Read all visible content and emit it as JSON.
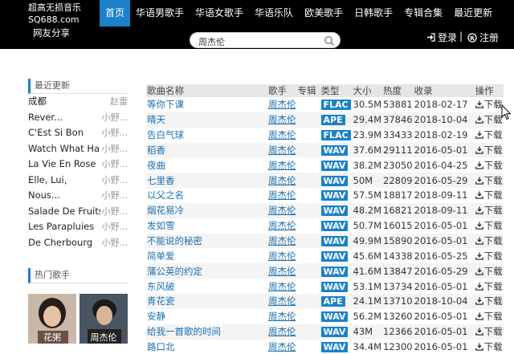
{
  "brand": {
    "line1": "超高无损音乐",
    "line2": "SQ688.com",
    "line3": "网友分享"
  },
  "nav": [
    {
      "label": "首页",
      "active": true
    },
    {
      "label": "华语男歌手"
    },
    {
      "label": "华语女歌手"
    },
    {
      "label": "华语乐队"
    },
    {
      "label": "欧美歌手"
    },
    {
      "label": "日韩歌手"
    },
    {
      "label": "专辑合集"
    },
    {
      "label": "最近更新"
    }
  ],
  "search": {
    "value": "周杰伦"
  },
  "auth": {
    "login": "登录",
    "register": "注册",
    "separator": "|"
  },
  "sidebar": {
    "recent_title": "最近更新",
    "recent": [
      {
        "title": "成都",
        "uploader": "赵雷"
      },
      {
        "title": "Rever...",
        "uploader": "小野..."
      },
      {
        "title": "C'Est Si Bon",
        "uploader": "小野..."
      },
      {
        "title": "Watch What Happens",
        "uploader": "小野..."
      },
      {
        "title": "La Vie En Rose",
        "uploader": "小野..."
      },
      {
        "title": "Elle, Lui,",
        "uploader": "小野..."
      },
      {
        "title": "Nous...",
        "uploader": "小野..."
      },
      {
        "title": "Salade De Fruits",
        "uploader": "小野..."
      },
      {
        "title": "Les Parapluies",
        "uploader": "小野..."
      },
      {
        "title": "De Cherbourg",
        "uploader": "小野..."
      }
    ],
    "hot_title": "热门歌手",
    "singers": [
      {
        "name": "花粥"
      },
      {
        "name": "周杰伦"
      }
    ]
  },
  "table": {
    "headers": {
      "name": "歌曲名称",
      "singer": "歌手",
      "album": "专辑",
      "type": "类型",
      "size": "大小",
      "hot": "热度",
      "date": "收录",
      "action": "操作"
    },
    "rows": [
      {
        "name": "等你下课",
        "singer": "周杰伦",
        "type": "FLAC",
        "size": "30.5M",
        "hot": "53881",
        "date": "2018-02-17",
        "action": "下载"
      },
      {
        "name": "晴天",
        "singer": "周杰伦",
        "type": "APE",
        "size": "29.4M",
        "hot": "37846",
        "date": "2018-10-04",
        "action": "下载"
      },
      {
        "name": "告白气球",
        "singer": "周杰伦",
        "type": "FLAC",
        "size": "23.9M",
        "hot": "33433",
        "date": "2018-02-19",
        "action": "下载"
      },
      {
        "name": "稻香",
        "singer": "周杰伦",
        "type": "WAV",
        "size": "37.6M",
        "hot": "29111",
        "date": "2016-05-01",
        "action": "下载"
      },
      {
        "name": "夜曲",
        "singer": "周杰伦",
        "type": "WAV",
        "size": "38.2M",
        "hot": "23050",
        "date": "2016-04-25",
        "action": "下载"
      },
      {
        "name": "七里香",
        "singer": "周杰伦",
        "type": "WAV",
        "size": "50M",
        "hot": "22809",
        "date": "2016-05-29",
        "action": "下载"
      },
      {
        "name": "以父之名",
        "singer": "周杰伦",
        "type": "WAV",
        "size": "57.5M",
        "hot": "18817",
        "date": "2018-09-11",
        "action": "下载"
      },
      {
        "name": "烟花易冷",
        "singer": "周杰伦",
        "type": "WAV",
        "size": "48.2M",
        "hot": "16821",
        "date": "2018-09-11",
        "action": "下载"
      },
      {
        "name": "发如雪",
        "singer": "周杰伦",
        "type": "WAV",
        "size": "50.7M",
        "hot": "16015",
        "date": "2016-05-01",
        "action": "下载"
      },
      {
        "name": "不能说的秘密",
        "singer": "周杰伦",
        "type": "WAV",
        "size": "49.9M",
        "hot": "15890",
        "date": "2016-05-01",
        "action": "下载"
      },
      {
        "name": "简单爱",
        "singer": "周杰伦",
        "type": "WAV",
        "size": "45.6M",
        "hot": "14338",
        "date": "2016-05-25",
        "action": "下载"
      },
      {
        "name": "蒲公英的约定",
        "singer": "周杰伦",
        "type": "WAV",
        "size": "41.6M",
        "hot": "13847",
        "date": "2016-05-29",
        "action": "下载"
      },
      {
        "name": "东风破",
        "singer": "周杰伦",
        "type": "WAV",
        "size": "53.1M",
        "hot": "13734",
        "date": "2016-05-01",
        "action": "下载"
      },
      {
        "name": "青花瓷",
        "singer": "周杰伦",
        "type": "APE",
        "size": "24.1M",
        "hot": "13710",
        "date": "2018-10-04",
        "action": "下载"
      },
      {
        "name": "安静",
        "singer": "周杰伦",
        "type": "WAV",
        "size": "56.2M",
        "hot": "13260",
        "date": "2016-05-01",
        "action": "下载"
      },
      {
        "name": "给我一首歌的时间",
        "singer": "周杰伦",
        "type": "WAV",
        "size": "43M",
        "hot": "12366",
        "date": "2016-05-01",
        "action": "下载"
      },
      {
        "name": "路口北",
        "singer": "周杰伦",
        "type": "WAV",
        "size": "34.4M",
        "hot": "12300",
        "date": "2016-05-01",
        "action": "下载"
      }
    ]
  },
  "colors": {
    "accent": "#1a82c9",
    "topbar": "#000000",
    "link": "#1a6fb0"
  }
}
